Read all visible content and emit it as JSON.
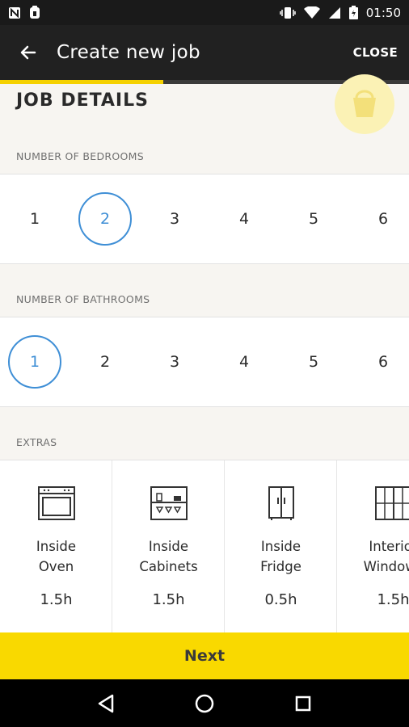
{
  "status_bar": {
    "time": "01:50"
  },
  "app_bar": {
    "title": "Create new job",
    "close_label": "CLOSE"
  },
  "progress": {
    "fraction": 0.4
  },
  "section": {
    "title": "JOB DETAILS"
  },
  "bedrooms": {
    "label": "NUMBER OF BEDROOMS",
    "options": [
      "1",
      "2",
      "3",
      "4",
      "5",
      "6"
    ],
    "selected": "2"
  },
  "bathrooms": {
    "label": "NUMBER OF BATHROOMS",
    "options": [
      "1",
      "2",
      "3",
      "4",
      "5",
      "6"
    ],
    "selected": "1"
  },
  "extras": {
    "label": "EXTRAS",
    "items": [
      {
        "name_line1": "Inside",
        "name_line2": "Oven",
        "duration": "1.5h",
        "icon": "oven-icon"
      },
      {
        "name_line1": "Inside",
        "name_line2": "Cabinets",
        "duration": "1.5h",
        "icon": "cabinets-icon"
      },
      {
        "name_line1": "Inside",
        "name_line2": "Fridge",
        "duration": "0.5h",
        "icon": "fridge-icon"
      },
      {
        "name_line1": "Interior",
        "name_line2": "Windows",
        "duration": "1.5h",
        "icon": "windows-icon"
      }
    ]
  },
  "next_button": {
    "label": "Next"
  },
  "colors": {
    "accent": "#f9d900",
    "selected": "#3f8fd6",
    "appbar": "#212121"
  }
}
